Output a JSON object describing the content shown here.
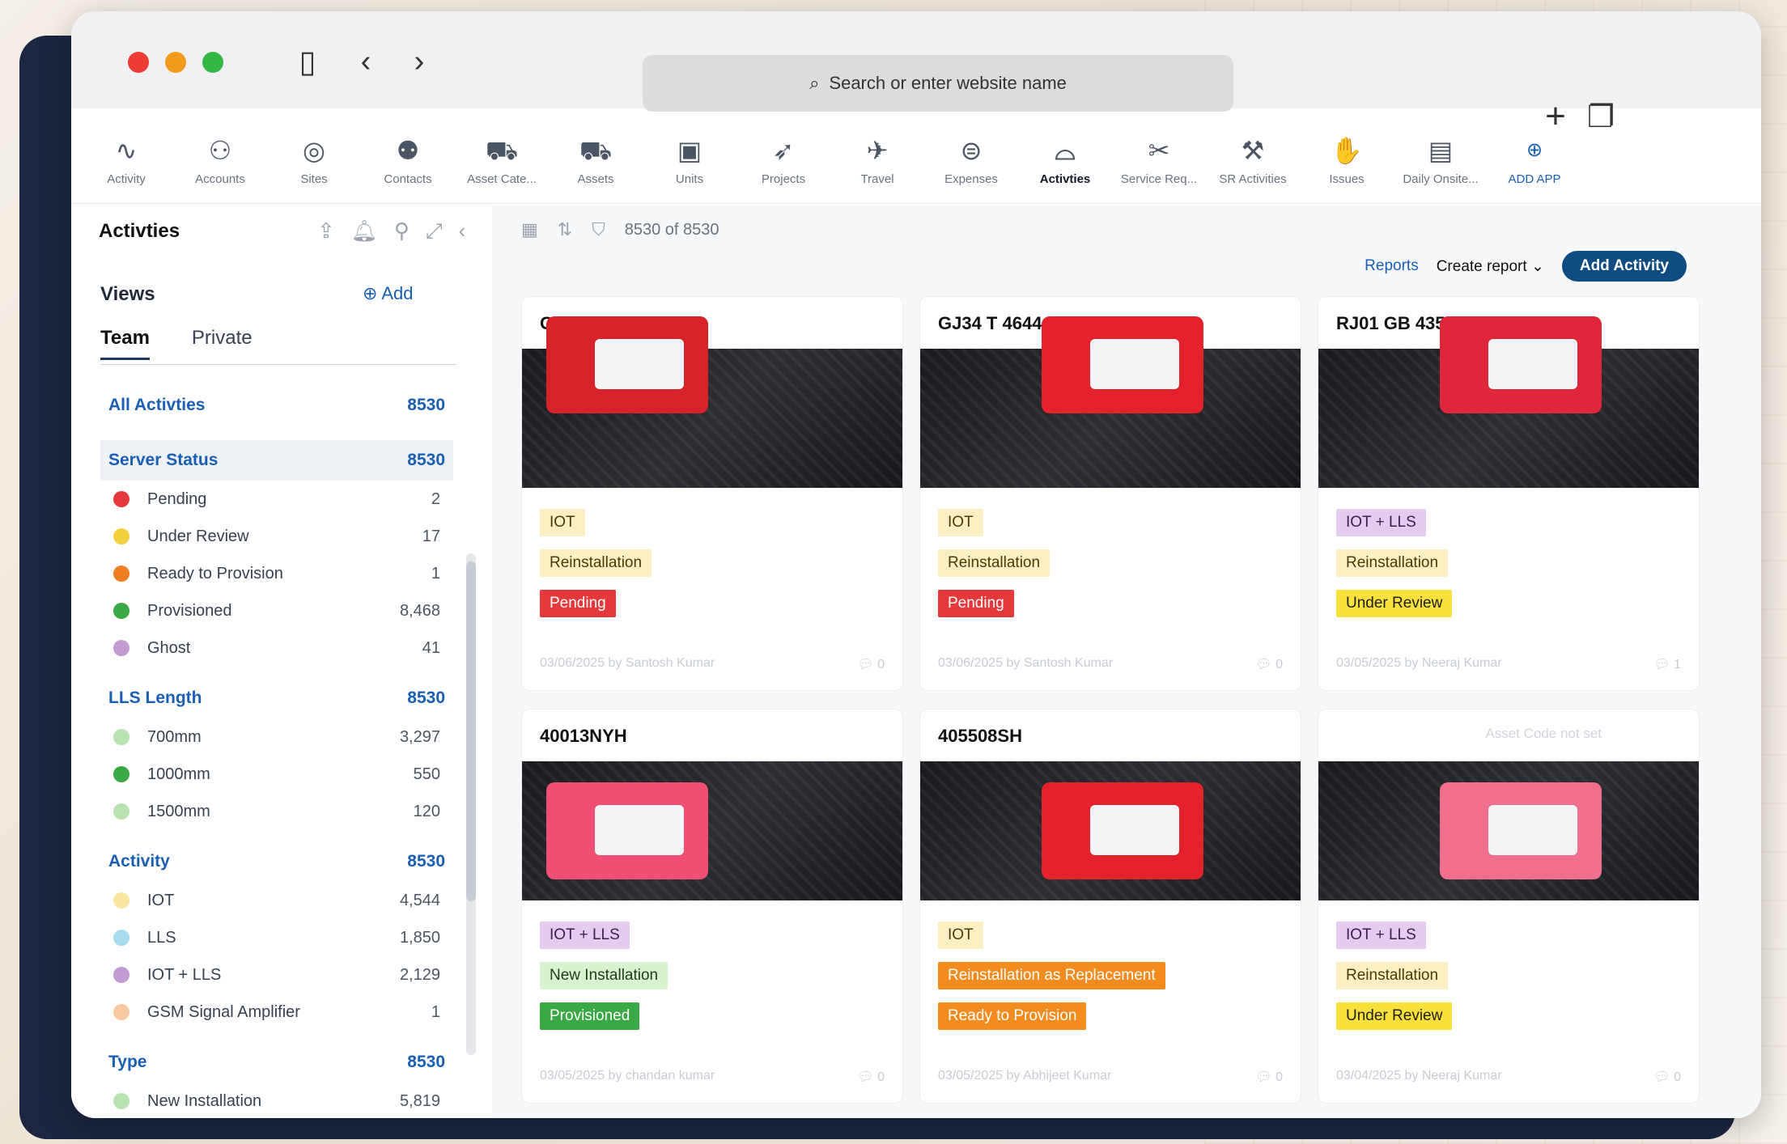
{
  "browser": {
    "url_placeholder": "Search or enter website name"
  },
  "nav": [
    {
      "label": "Activity",
      "icon": "pulse-icon"
    },
    {
      "label": "Accounts",
      "icon": "accounts-icon"
    },
    {
      "label": "Sites",
      "icon": "location-pin-icon"
    },
    {
      "label": "Contacts",
      "icon": "contacts-icon"
    },
    {
      "label": "Asset Cate...",
      "icon": "bus-icon"
    },
    {
      "label": "Assets",
      "icon": "truck-icon"
    },
    {
      "label": "Units",
      "icon": "unit-icon"
    },
    {
      "label": "Projects",
      "icon": "rocket-icon"
    },
    {
      "label": "Travel",
      "icon": "plane-icon"
    },
    {
      "label": "Expenses",
      "icon": "money-icon"
    },
    {
      "label": "Activties",
      "icon": "shoe-icon",
      "active": true
    },
    {
      "label": "Service Req...",
      "icon": "tools-icon"
    },
    {
      "label": "SR Activities",
      "icon": "wrench-icon"
    },
    {
      "label": "Issues",
      "icon": "hand-icon"
    },
    {
      "label": "Daily Onsite...",
      "icon": "calendar-icon"
    },
    {
      "label": "ADD APP",
      "icon": "add-circle-icon"
    }
  ],
  "sidebar": {
    "title": "Activties",
    "views_label": "Views",
    "add_label": "Add",
    "tabs": [
      "Team",
      "Private"
    ],
    "all_label": "All Activties",
    "all_count": "8530",
    "groups": [
      {
        "title": "Server Status",
        "count": "8530",
        "items": [
          {
            "label": "Pending",
            "count": "2",
            "color": "#e5383b"
          },
          {
            "label": "Under Review",
            "count": "17",
            "color": "#f4d03f"
          },
          {
            "label": "Ready to Provision",
            "count": "1",
            "color": "#ef7d21"
          },
          {
            "label": "Provisioned",
            "count": "8,468",
            "color": "#3aa845"
          },
          {
            "label": "Ghost",
            "count": "41",
            "color": "#c39bd3"
          }
        ]
      },
      {
        "title": "LLS Length",
        "count": "8530",
        "items": [
          {
            "label": "700mm",
            "count": "3,297",
            "color": "#b8e3b0"
          },
          {
            "label": "1000mm",
            "count": "550",
            "color": "#3aa845"
          },
          {
            "label": "1500mm",
            "count": "120",
            "color": "#b8e3b0"
          }
        ]
      },
      {
        "title": "Activity",
        "count": "8530",
        "items": [
          {
            "label": "IOT",
            "count": "4,544",
            "color": "#f9e7a1"
          },
          {
            "label": "LLS",
            "count": "1,850",
            "color": "#a7dcef"
          },
          {
            "label": "IOT + LLS",
            "count": "2,129",
            "color": "#c39bd3"
          },
          {
            "label": "GSM Signal Amplifier",
            "count": "1",
            "color": "#f8c9a0"
          }
        ]
      },
      {
        "title": "Type",
        "count": "8530",
        "items": [
          {
            "label": "New Installation",
            "count": "5,819",
            "color": "#b8e3b0"
          }
        ]
      }
    ]
  },
  "main": {
    "count_text": "8530 of 8530",
    "reports": "Reports",
    "create_report": "Create report",
    "add_activity": "Add Activity"
  },
  "cards": [
    {
      "title": "GJ37 T 3436",
      "tags": [
        {
          "text": "IOT",
          "bg": "#fbefc3",
          "fg": "#4b3b00"
        },
        {
          "text": "Reinstallation",
          "bg": "#fbefc3",
          "fg": "#4b3b00"
        },
        {
          "text": "Pending",
          "bg": "#e5383b",
          "fg": "#ffffff"
        }
      ],
      "footer": "03/06/2025 by Santosh Kumar",
      "comments": "0",
      "sim": "#d6232a"
    },
    {
      "title": "GJ34 T 4644",
      "tags": [
        {
          "text": "IOT",
          "bg": "#fbefc3",
          "fg": "#4b3b00"
        },
        {
          "text": "Reinstallation",
          "bg": "#fbefc3",
          "fg": "#4b3b00"
        },
        {
          "text": "Pending",
          "bg": "#e5383b",
          "fg": "#ffffff"
        }
      ],
      "footer": "03/06/2025 by Santosh Kumar",
      "comments": "0",
      "sim": "#e3222b"
    },
    {
      "title": "RJ01 GB 4357",
      "tags": [
        {
          "text": "IOT + LLS",
          "bg": "#e3ccf0",
          "fg": "#3b1f4d"
        },
        {
          "text": "Reinstallation",
          "bg": "#fbefc3",
          "fg": "#4b3b00"
        },
        {
          "text": "Under Review",
          "bg": "#f7e13a",
          "fg": "#1f1f1f"
        }
      ],
      "footer": "03/05/2025 by Neeraj Kumar",
      "comments": "1",
      "sim": "#e0263a"
    },
    {
      "title": "40013NYH",
      "tags": [
        {
          "text": "IOT + LLS",
          "bg": "#e3ccf0",
          "fg": "#3b1f4d"
        },
        {
          "text": "New Installation",
          "bg": "#d9f2cf",
          "fg": "#1f3d16"
        },
        {
          "text": "Provisioned",
          "bg": "#3aa845",
          "fg": "#ffffff"
        }
      ],
      "footer": "03/05/2025 by chandan kumar",
      "comments": "0",
      "sim": "#ef4f72"
    },
    {
      "title": "405508SH",
      "tags": [
        {
          "text": "IOT",
          "bg": "#fbefc3",
          "fg": "#4b3b00"
        },
        {
          "text": "Reinstallation as Replacement",
          "bg": "#f28c1f",
          "fg": "#ffffff"
        },
        {
          "text": "Ready to Provision",
          "bg": "#f28c1f",
          "fg": "#ffffff"
        }
      ],
      "footer": "03/05/2025 by Abhijeet Kumar",
      "comments": "0",
      "sim": "#e3222b"
    },
    {
      "title": "Asset Code not set",
      "tags": [
        {
          "text": "IOT + LLS",
          "bg": "#e3ccf0",
          "fg": "#3b1f4d"
        },
        {
          "text": "Reinstallation",
          "bg": "#fbefc3",
          "fg": "#4b3b00"
        },
        {
          "text": "Under Review",
          "bg": "#f7e13a",
          "fg": "#1f1f1f"
        }
      ],
      "footer": "03/04/2025 by Neeraj Kumar",
      "comments": "0",
      "sim": "#ef6f8c",
      "muted_title": true
    }
  ]
}
